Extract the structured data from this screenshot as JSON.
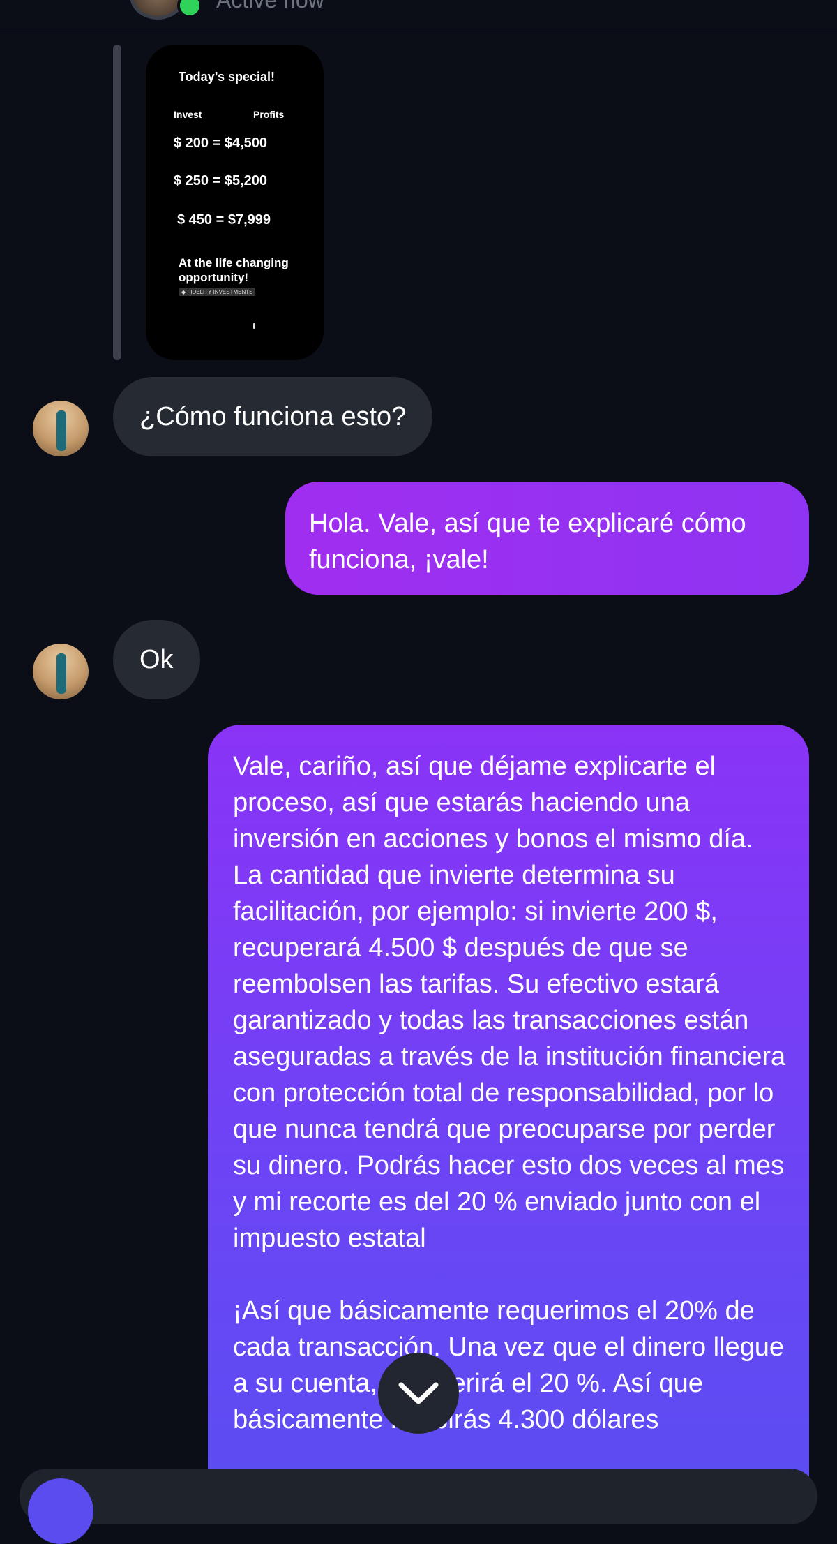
{
  "header": {
    "status": "Active now"
  },
  "shared_image": {
    "title": "Today’s special!",
    "col_invest": "Invest",
    "col_profits": "Profits",
    "rows": [
      "$ 200 = $4,500",
      "$ 250 = $5,200",
      "$ 450 = $7,999"
    ],
    "tagline": "At the life changing opportunity!",
    "brand": "◆ FIDELITY INVESTMENTS"
  },
  "messages": [
    {
      "sender": "them",
      "text": "¿Cómo funciona esto?"
    },
    {
      "sender": "me",
      "text": "Hola. Vale, así que te explicaré cómo funciona, ¡vale!"
    },
    {
      "sender": "them",
      "text": "Ok"
    },
    {
      "sender": "me",
      "text_p1": "Vale, cariño, así que déjame explicarte el proceso, así que estarás haciendo una inversión en acciones y bonos el mismo día. La cantidad que invierte determina su facilitación, por ejemplo: si invierte 200 $, recuperará 4.500 $ después de que se reembolsen las tarifas. Su efectivo estará garantizado y todas las transacciones están aseguradas a través de la institución financiera con protección total de responsabilidad, por lo que nunca tendrá que preocuparse por perder su dinero. Podrás hacer esto dos veces al mes y mi recorte es del 20 % enviado junto con el impuesto estatal",
      "text_p2": "¡Así que básicamente requerimos el 20% de cada transacción. Una vez que el dinero llegue a su cuenta, transferirá el 20 %. Así que básicamente recibirás 4.300 dólares"
    }
  ],
  "icons": {
    "scroll_down": "chevron-down-icon"
  },
  "colors": {
    "outgoing_top": "#8a33f6",
    "outgoing_bottom": "#5a4ef2",
    "incoming": "#262a33",
    "background": "#0b0e17",
    "online": "#2fd35a"
  }
}
